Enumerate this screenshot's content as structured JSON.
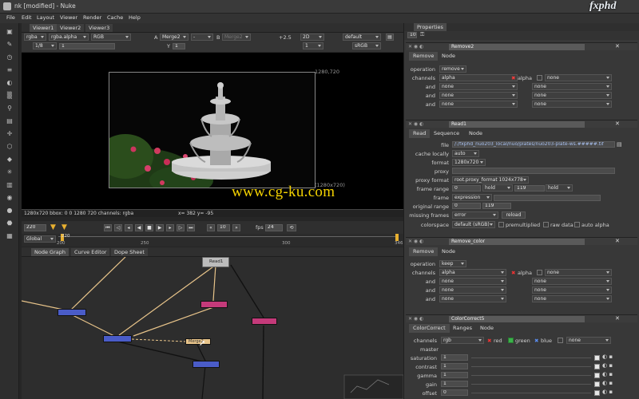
{
  "window": {
    "title": "nk [modified] - Nuke"
  },
  "menu": [
    "File",
    "Edit",
    "Layout",
    "Viewer",
    "Render",
    "Cache",
    "Help"
  ],
  "viewer_tabs": [
    "Viewer1",
    "Viewer2",
    "Viewer3",
    "Viewer2"
  ],
  "viewer_controls": {
    "channel_set": "rgba",
    "alpha_channel": "rgba.alpha",
    "display_channels": "RGB",
    "input_a": "Merge2",
    "input_a_label": "A",
    "operation": "-",
    "input_b_label": "B",
    "input_b": "Merge2",
    "gain": "+2.5",
    "view_mode": "2D",
    "lut": "default",
    "downrez": "1/8",
    "frame": "1",
    "y_label": "Y",
    "y_value": "1",
    "proxy_value": "1",
    "colorspace": "sRGB"
  },
  "viewer": {
    "format_top": "1280,720",
    "format_bottom": "(1280x720)",
    "info": "1280x720 bbox: 0 0 1280 720 channels: rgba",
    "cursor": "x= 382 y= -95"
  },
  "watermark": "www.cg-ku.com",
  "brand": "fxphd",
  "transport": {
    "current_frame": "220",
    "step": "10",
    "fps_label": "fps",
    "fps": "24"
  },
  "timeline": {
    "scope": "Global",
    "start": "200",
    "ticks": [
      "220",
      "250",
      "300"
    ],
    "end": "346"
  },
  "graph_tabs": [
    "Node Graph",
    "Curve Editor",
    "Dope Sheet"
  ],
  "graph_nodes": {
    "read": "Read1",
    "merge": "Merge2"
  },
  "properties": {
    "title": "Properties",
    "count": "10",
    "remove2": {
      "name": "Remove2",
      "tabs": [
        "Remove",
        "Node"
      ],
      "operation_label": "operation",
      "operation": "remove",
      "channels_label": "channels",
      "channels": "alpha",
      "alpha_label": "alpha",
      "channels_extra": "none",
      "and_label": "and",
      "none": "none"
    },
    "read1": {
      "name": "Read1",
      "tabs": [
        "Read",
        "Sequence",
        "Node"
      ],
      "file_label": "file",
      "file": "/:/fxphd_nuo203_local/nuo/plates/nuo203-plate-ws.#####.tif",
      "cache_locally_label": "cache locally",
      "cache_locally": "auto",
      "format_label": "format",
      "format": "1280x720",
      "proxy_label": "proxy",
      "proxy_format_label": "proxy format",
      "proxy_format": "root.proxy_format 1024x778",
      "frame_range_label": "frame range",
      "frame_range_start": "0",
      "frame_range_start_mode": "hold",
      "frame_range_end": "119",
      "frame_range_end_mode": "hold",
      "frame_label": "frame",
      "frame_mode": "expression",
      "original_range_label": "original range",
      "original_start": "0",
      "original_end": "119",
      "missing_frames_label": "missing frames",
      "missing_frames": "error",
      "reload": "reload",
      "colorspace_label": "colorspace",
      "colorspace": "default (sRGB)",
      "premultiplied": "premultiplied",
      "raw_data": "raw data",
      "auto_alpha": "auto alpha"
    },
    "remove_color": {
      "name": "Remove_color",
      "tabs": [
        "Remove",
        "Node"
      ],
      "operation_label": "operation",
      "operation": "keep",
      "channels_label": "channels",
      "channels": "alpha",
      "alpha_label": "alpha",
      "channels_extra": "none",
      "and_label": "and",
      "none": "none"
    },
    "colorcorrect5": {
      "name": "ColorCorrect5",
      "tabs": [
        "ColorCorrect",
        "Ranges",
        "Node"
      ],
      "channels_label": "channels",
      "channels": "rgb",
      "red": "red",
      "green": "green",
      "blue": "blue",
      "channels_extra": "none",
      "master_label": "master",
      "params": [
        {
          "label": "saturation",
          "value": "1"
        },
        {
          "label": "contrast",
          "value": "1"
        },
        {
          "label": "gamma",
          "value": "1"
        },
        {
          "label": "gain",
          "value": "1"
        },
        {
          "label": "offset",
          "value": "0"
        }
      ]
    }
  },
  "colors": {
    "accent": "#f5d300",
    "read_node": "#bcbcbc",
    "merge_node": "#4a5cc8",
    "pink_node": "#c43a7a",
    "orange_node": "#e8c48a"
  }
}
